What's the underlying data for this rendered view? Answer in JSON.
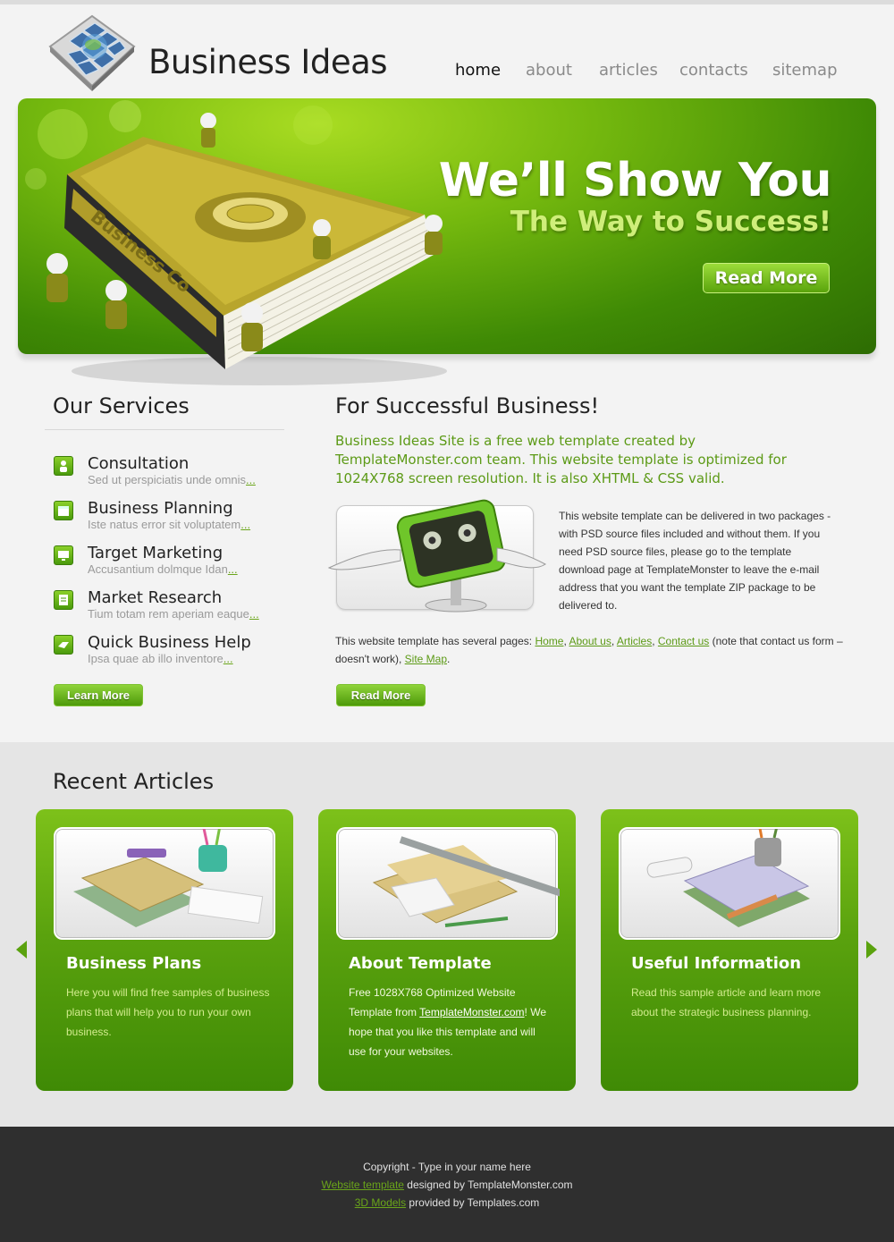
{
  "header": {
    "brand": "Business Ideas",
    "nav": [
      "home",
      "about",
      "articles",
      "contacts",
      "sitemap"
    ],
    "active_nav": "home"
  },
  "hero": {
    "title": "We’ll Show You",
    "subtitle": "The Way to Success!",
    "button": "Read More",
    "book_lettering": "Business Co"
  },
  "services": {
    "title": "Our Services",
    "items": [
      {
        "title": "Consultation",
        "desc": "Sed ut perspiciatis unde omnis",
        "more": "...",
        "icon": "consultation-icon"
      },
      {
        "title": "Business Planning",
        "desc": "Iste natus error sit voluptatem",
        "more": "...",
        "icon": "calendar-icon"
      },
      {
        "title": "Target Marketing",
        "desc": "Accusantium dolmque Idan",
        "more": "...",
        "icon": "monitor-icon"
      },
      {
        "title": "Market Research",
        "desc": "Tium totam rem aperiam eaque",
        "more": "...",
        "icon": "document-icon"
      },
      {
        "title": "Quick Business Help",
        "desc": "Ipsa quae ab illo inventore",
        "more": "...",
        "icon": "handshake-icon"
      }
    ],
    "button": "Learn More"
  },
  "business": {
    "title": "For Successful Business!",
    "intro": "Business Ideas Site is a free web template created by TemplateMonster.com team. This website template is optimized for 1024X768 screen resolution. It is also XHTML & CSS valid.",
    "body": "This website template can be delivered in two packages - with PSD source files included and without them. If you need PSD source files, please go to the template download page at TemplateMonster to leave the e-mail address that you want the template ZIP package to be delivered to.",
    "pages_prefix": "This website template has several pages: ",
    "links": [
      "Home",
      "About us",
      "Articles",
      "Contact us"
    ],
    "pages_note": " (note that contact us form – doesn't work), ",
    "sitemap_link": "Site Map",
    "pages_end": ".",
    "button": "Read More"
  },
  "articles": {
    "title": "Recent Articles",
    "cards": [
      {
        "title": "Business Plans",
        "text": "Here you will find free samples of business plans that will help you to run your own business."
      },
      {
        "title": "About Template",
        "text_before": "Free 1028X768 Optimized Website Template from ",
        "link": "TemplateMonster.com",
        "text_after": "! We hope that you like this template and will use for your websites."
      },
      {
        "title": "Useful Information",
        "text": "Read this sample article and learn more about the strategic business planning."
      }
    ]
  },
  "footer": {
    "line1": "Copyright - Type in your name here",
    "link2": "Website template",
    "line2": " designed by TemplateMonster.com",
    "link3": "3D Models",
    "line3": " provided by Templates.com"
  },
  "colors": {
    "accent": "#5c9a16",
    "hero_green": "#4f9a08",
    "footer_bg": "#2f2f2f"
  }
}
